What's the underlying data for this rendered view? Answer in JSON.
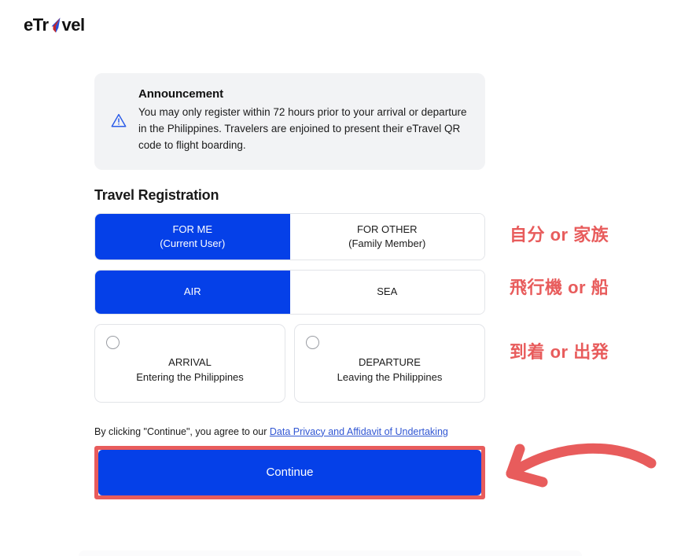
{
  "brand": {
    "name_part1": "eTr",
    "name_part2": "vel",
    "logo_icon": "etravel-arrow-logo",
    "black": "#111111",
    "blue": "#2b4fd6",
    "red": "#c1272d"
  },
  "announcement": {
    "icon": "warning-triangle-icon",
    "title": "Announcement",
    "text": "You may only register within 72 hours prior to your arrival or departure in the Philippines. Travelers are enjoined to present their eTravel QR code to flight boarding.",
    "background": "#f2f3f5",
    "icon_color": "#2b5ce8"
  },
  "section": {
    "title": "Travel Registration"
  },
  "registrant_toggle": {
    "name": "registrant-type",
    "options": [
      {
        "label": "FOR ME",
        "sublabel": "(Current User)",
        "selected": true
      },
      {
        "label": "FOR OTHER",
        "sublabel": "(Family Member)",
        "selected": false
      }
    ]
  },
  "mode_toggle": {
    "name": "travel-mode",
    "options": [
      {
        "label": "AIR",
        "sublabel": "",
        "selected": true
      },
      {
        "label": "SEA",
        "sublabel": "",
        "selected": false
      }
    ]
  },
  "direction_cards": [
    {
      "title": "ARRIVAL",
      "subtitle": "Entering the Philippines",
      "selected": false
    },
    {
      "title": "DEPARTURE",
      "subtitle": "Leaving the Philippines",
      "selected": false
    }
  ],
  "consent": {
    "prefix": "By clicking \"Continue\", you agree to our ",
    "link_text": "Data Privacy and Affidavit of Undertaking"
  },
  "continue": {
    "label": "Continue",
    "button_color": "#0540e8",
    "highlight_color": "#e85c5c"
  },
  "annotations": {
    "color": "#e85c5c",
    "items": [
      {
        "text": "自分 or 家族"
      },
      {
        "text": "飛行機 or 船"
      },
      {
        "text": "到着 or 出発"
      }
    ],
    "arrow": "curved-arrow-left-icon"
  }
}
